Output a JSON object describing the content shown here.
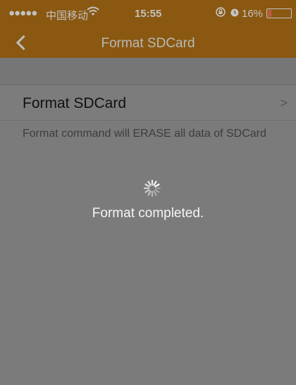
{
  "status_bar": {
    "signal": "●●●●●",
    "carrier": "中国移动",
    "wifi_icon": "wifi-icon",
    "time": "15:55",
    "lock_icon": "rotation-lock-icon",
    "alarm_icon": "alarm-icon",
    "battery_percent": "16%",
    "battery_level": 0.16,
    "battery_color": "#c05a42"
  },
  "nav": {
    "back_icon": "chevron-left-icon",
    "title": "Format SDCard",
    "bar_color": "#8a5810"
  },
  "settings_row": {
    "label": "Format SDCard",
    "chevron": ">"
  },
  "description": "Format command will ERASE all data of SDCard",
  "progress": {
    "spinner_icon": "spinner-icon",
    "message": "Format completed."
  }
}
